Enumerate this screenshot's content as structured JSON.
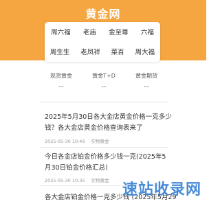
{
  "header": {
    "logo_text": "黄金网",
    "brand_color": "#f5a640"
  },
  "brands": {
    "row1": [
      "周六福",
      "老庙",
      "金至尊",
      "六福"
    ],
    "row2": [
      "周生生",
      "老凤祥",
      "菜百",
      "周大福"
    ]
  },
  "price_tabs": [
    {
      "name": "现货黄金",
      "value": "--"
    },
    {
      "name": "黄金T+D",
      "value": "--"
    },
    {
      "name": "黄金期货",
      "value": "--"
    }
  ],
  "news": [
    {
      "title": "2025年5月30日各大金店黄金价格一克多少钱？各大金店黄金价格查询表来了",
      "time": "2025-05-30 10:49",
      "category": "实物黄金"
    },
    {
      "title": "今日各金店铂金价格多少钱一克(2025年5月30日铂金价格汇总)",
      "time": "2025-05-30 10:35",
      "category": "实物黄金"
    },
    {
      "title": "各大金店铂金价格一克多少钱 (2025年5月29",
      "time": "",
      "category": ""
    }
  ],
  "watermark": {
    "text": "速站收录网",
    "color": "#2878d2"
  }
}
